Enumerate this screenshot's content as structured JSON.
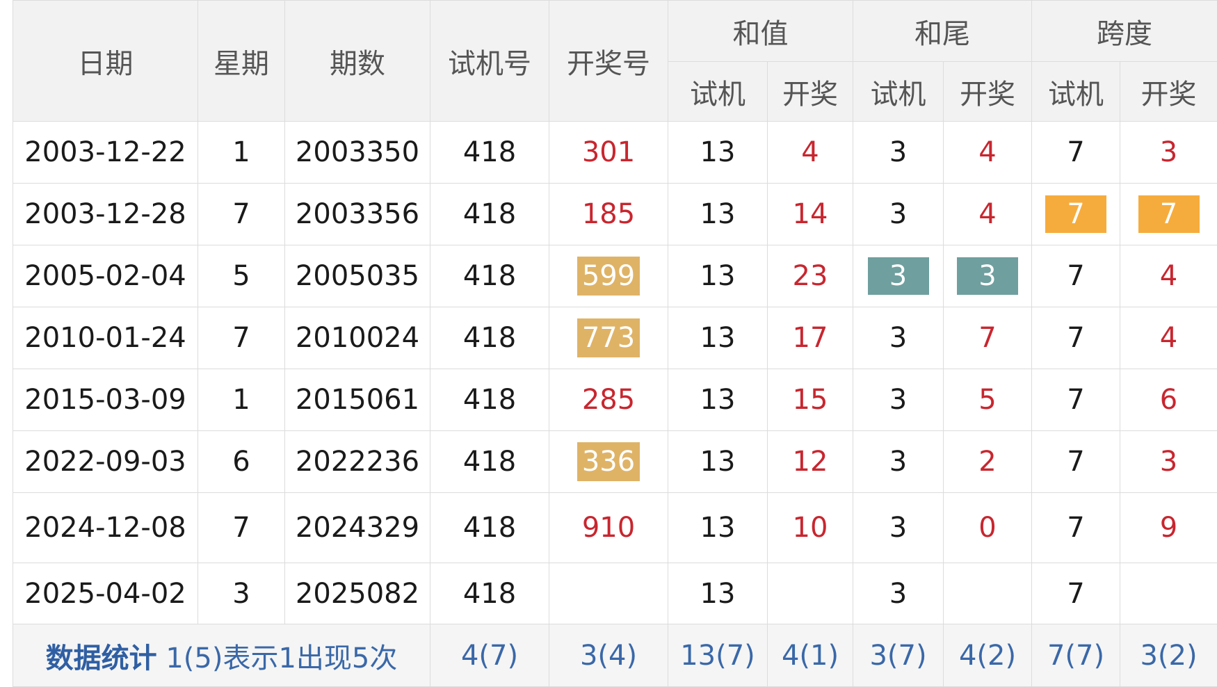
{
  "header": {
    "date": "日期",
    "weekday": "星期",
    "period": "期数",
    "trial": "试机号",
    "draw": "开奖号",
    "sum": "和值",
    "tail": "和尾",
    "span": "跨度",
    "sub_trial": "试机",
    "sub_draw": "开奖"
  },
  "rows": [
    {
      "date": "2003-12-22",
      "weekday": "1",
      "period": "2003350",
      "trial": "418",
      "draw": "301",
      "sum_trial": "13",
      "sum_draw": "4",
      "tail_trial": "3",
      "tail_draw": "4",
      "span_trial": "7",
      "span_draw": "3"
    },
    {
      "date": "2003-12-28",
      "weekday": "7",
      "period": "2003356",
      "trial": "418",
      "draw": "185",
      "sum_trial": "13",
      "sum_draw": "14",
      "tail_trial": "3",
      "tail_draw": "4",
      "span_trial": "7",
      "span_draw": "7"
    },
    {
      "date": "2005-02-04",
      "weekday": "5",
      "period": "2005035",
      "trial": "418",
      "draw": "599",
      "sum_trial": "13",
      "sum_draw": "23",
      "tail_trial": "3",
      "tail_draw": "3",
      "span_trial": "7",
      "span_draw": "4"
    },
    {
      "date": "2010-01-24",
      "weekday": "7",
      "period": "2010024",
      "trial": "418",
      "draw": "773",
      "sum_trial": "13",
      "sum_draw": "17",
      "tail_trial": "3",
      "tail_draw": "7",
      "span_trial": "7",
      "span_draw": "4"
    },
    {
      "date": "2015-03-09",
      "weekday": "1",
      "period": "2015061",
      "trial": "418",
      "draw": "285",
      "sum_trial": "13",
      "sum_draw": "15",
      "tail_trial": "3",
      "tail_draw": "5",
      "span_trial": "7",
      "span_draw": "6"
    },
    {
      "date": "2022-09-03",
      "weekday": "6",
      "period": "2022236",
      "trial": "418",
      "draw": "336",
      "sum_trial": "13",
      "sum_draw": "12",
      "tail_trial": "3",
      "tail_draw": "2",
      "span_trial": "7",
      "span_draw": "3"
    },
    {
      "date": "2024-12-08",
      "weekday": "7",
      "period": "2024329",
      "trial": "418",
      "draw": "910",
      "sum_trial": "13",
      "sum_draw": "10",
      "tail_trial": "3",
      "tail_draw": "0",
      "span_trial": "7",
      "span_draw": "9"
    },
    {
      "date": "2025-04-02",
      "weekday": "3",
      "period": "2025082",
      "trial": "418",
      "draw": "",
      "sum_trial": "13",
      "sum_draw": "",
      "tail_trial": "3",
      "tail_draw": "",
      "span_trial": "7",
      "span_draw": ""
    }
  ],
  "stats": {
    "title": "数据统计",
    "note": "1(5)表示1出现5次",
    "trial": "4(7)",
    "draw": "3(4)",
    "sum_trial": "13(7)",
    "sum_draw": "4(1)",
    "tail_trial": "3(7)",
    "tail_draw": "4(2)",
    "span_trial": "7(7)",
    "span_draw": "3(2)"
  },
  "colors": {
    "highlight_tan": "#dfb366",
    "highlight_orange": "#f6ac3c",
    "highlight_teal": "#6f9f9f",
    "draw_red": "#c8262f",
    "stats_blue": "#3a68a8"
  }
}
